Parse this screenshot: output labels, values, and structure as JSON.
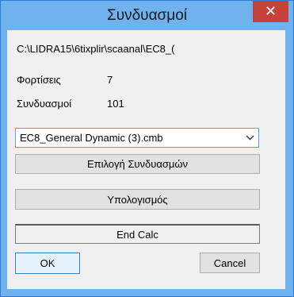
{
  "window": {
    "title": "Συνδυασμοί",
    "close_glyph": "✕"
  },
  "info": {
    "path": "C:\\LIDRA15\\6tixplir\\scaanal\\EC8_(",
    "loads_label": "Φορτίσεις",
    "loads_value": "7",
    "combos_label": "Συνδυασμοί",
    "combos_value": "101"
  },
  "combo_select": {
    "selected": "EC8_General Dynamic (3).cmb"
  },
  "buttons": {
    "select_combos": "Επιλογή Συνδυασμών",
    "calculate": "Υπολογισμός",
    "ok": "OK",
    "cancel": "Cancel"
  },
  "status": {
    "text": "End Calc"
  },
  "colors": {
    "titlebar": "#6fb2ee",
    "close": "#c7403a",
    "client": "#f0f0f0",
    "button": "#e1e1e1",
    "focus_border": "#3c7fb1"
  },
  "icons": {
    "close": "close-icon",
    "dropdown": "chevron-down-icon"
  }
}
